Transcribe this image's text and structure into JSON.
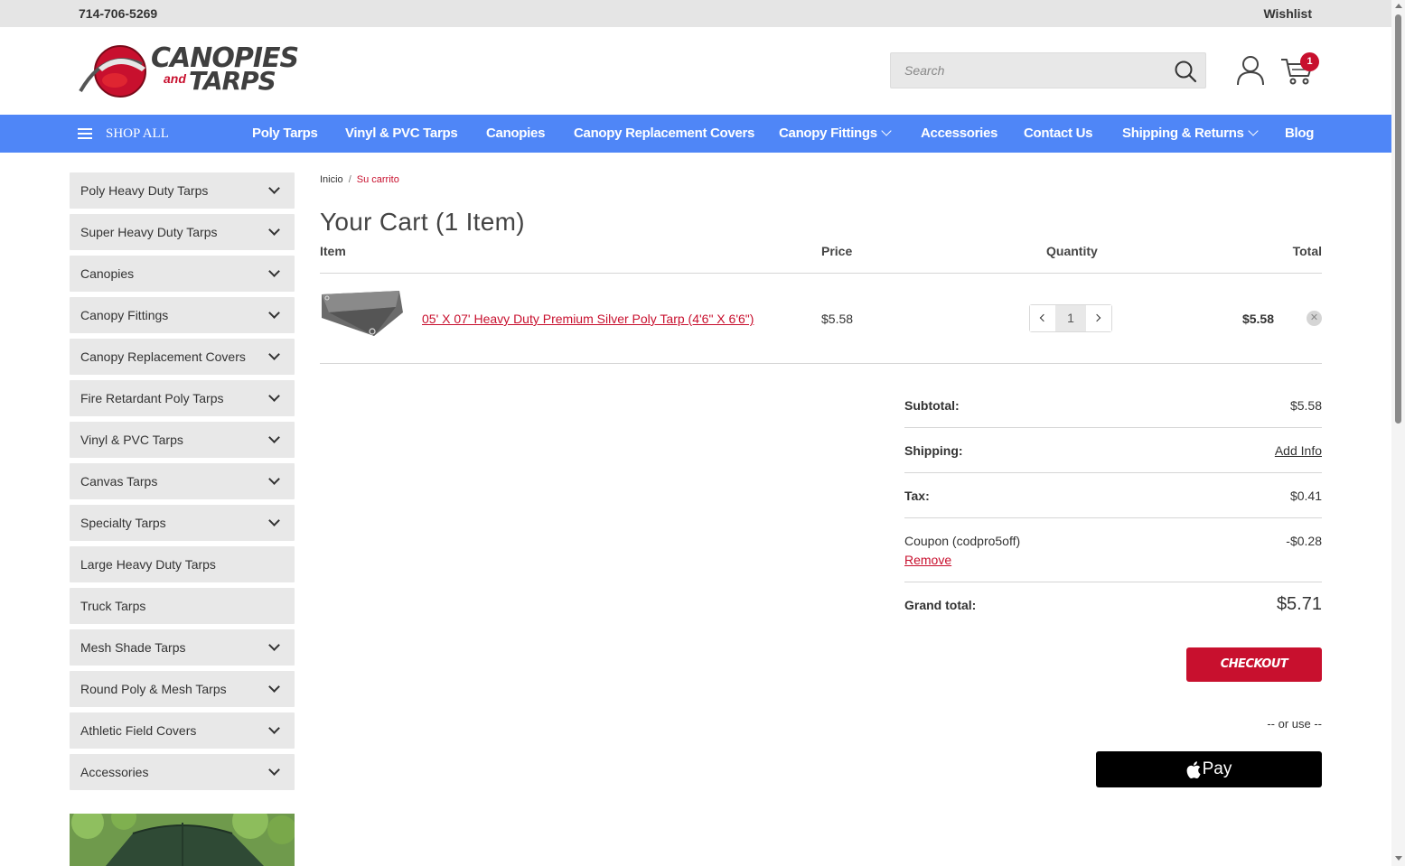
{
  "topbar": {
    "phone": "714-706-5269",
    "wishlist": "Wishlist"
  },
  "logo": {
    "line1": "CANOPIES",
    "and": "and",
    "line2": "TARPS"
  },
  "search": {
    "placeholder": "Search"
  },
  "cart": {
    "count": "1"
  },
  "nav": {
    "shop_all": "SHOP ALL",
    "items": [
      {
        "label": "Poly Tarps"
      },
      {
        "label": "Vinyl & PVC Tarps"
      },
      {
        "label": "Canopies"
      },
      {
        "label": "Canopy Replacement Covers"
      },
      {
        "label": "Canopy Fittings"
      },
      {
        "label": "Accessories"
      },
      {
        "label": "Contact Us"
      },
      {
        "label": "Shipping & Returns"
      },
      {
        "label": "Blog"
      }
    ]
  },
  "sidebar": {
    "items": [
      {
        "label": "Poly Heavy Duty Tarps"
      },
      {
        "label": "Super Heavy Duty Tarps"
      },
      {
        "label": "Canopies"
      },
      {
        "label": "Canopy Fittings"
      },
      {
        "label": "Canopy Replacement Covers"
      },
      {
        "label": "Fire Retardant Poly Tarps"
      },
      {
        "label": "Vinyl & PVC Tarps"
      },
      {
        "label": "Canvas Tarps"
      },
      {
        "label": "Specialty Tarps"
      },
      {
        "label": "Large Heavy Duty Tarps"
      },
      {
        "label": "Truck Tarps"
      },
      {
        "label": "Mesh Shade Tarps"
      },
      {
        "label": "Round Poly & Mesh Tarps"
      },
      {
        "label": "Athletic Field Covers"
      },
      {
        "label": "Accessories"
      }
    ]
  },
  "breadcrumb": {
    "home": "Inicio",
    "sep": "/",
    "current": "Su carrito"
  },
  "page_title": "Your Cart (1 Item)",
  "table": {
    "headers": {
      "item": "Item",
      "price": "Price",
      "quantity": "Quantity",
      "total": "Total"
    },
    "rows": [
      {
        "name": "05' X 07' Heavy Duty Premium Silver Poly Tarp (4'6\" X 6'6\")",
        "price": "$5.58",
        "quantity": "1",
        "total": "$5.58"
      }
    ]
  },
  "totals": {
    "subtotal_label": "Subtotal:",
    "subtotal_value": "$5.58",
    "shipping_label": "Shipping:",
    "shipping_value": "Add Info",
    "tax_label": "Tax:",
    "tax_value": "$0.41",
    "coupon_label": "Coupon (codpro5off)",
    "coupon_value": "-$0.28",
    "coupon_remove": "Remove",
    "grand_label": "Grand total:",
    "grand_value": "$5.71"
  },
  "checkout": {
    "label": "CHECKOUT",
    "or_use": "-- or use --",
    "applepay": "Pay"
  },
  "colors": {
    "accent": "#c8102e",
    "nav": "#4f86f7",
    "sidebar": "#e8e8e8"
  },
  "icons": [
    "search-icon",
    "user-icon",
    "cart-icon",
    "menu-icon",
    "chevron-down-icon",
    "close-icon",
    "apple-icon"
  ]
}
